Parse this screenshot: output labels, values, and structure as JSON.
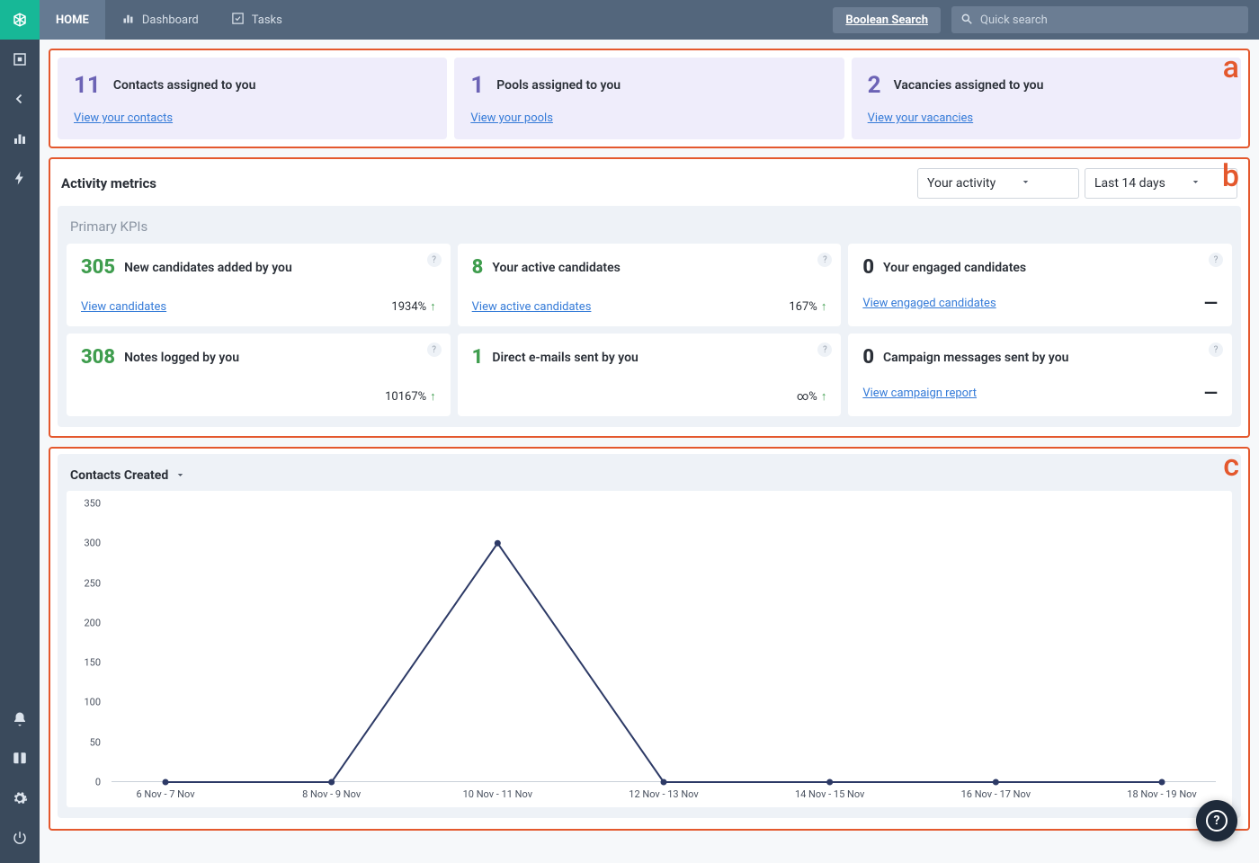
{
  "nav": {
    "home": "HOME",
    "dashboard": "Dashboard",
    "tasks": "Tasks",
    "booleanSearch": "Boolean Search",
    "quickSearchPlaceholder": "Quick search"
  },
  "annotations": {
    "a": "a",
    "b": "b",
    "c": "c"
  },
  "summary": [
    {
      "count": "11",
      "title": "Contacts assigned to you",
      "link": "View your contacts"
    },
    {
      "count": "1",
      "title": "Pools assigned to you",
      "link": "View your pools"
    },
    {
      "count": "2",
      "title": "Vacancies assigned to you",
      "link": "View your vacancies"
    }
  ],
  "metrics": {
    "title": "Activity metrics",
    "activitySelect": "Your activity",
    "rangeSelect": "Last 14 days",
    "kpiHeading": "Primary KPIs",
    "kpis": [
      {
        "value": "305",
        "valueStyle": "green",
        "label": "New candidates added by you",
        "link": "View candidates",
        "delta": "1934%",
        "trend": "up"
      },
      {
        "value": "8",
        "valueStyle": "green",
        "label": "Your active candidates",
        "link": "View active candidates",
        "delta": "167%",
        "trend": "up"
      },
      {
        "value": "0",
        "valueStyle": "dark",
        "label": "Your engaged candidates",
        "link": "View engaged candidates",
        "delta": "",
        "trend": "dash"
      },
      {
        "value": "308",
        "valueStyle": "green",
        "label": "Notes logged by you",
        "link": "",
        "delta": "10167%",
        "trend": "up"
      },
      {
        "value": "1",
        "valueStyle": "green",
        "label": "Direct e-mails sent by you",
        "link": "",
        "delta": "∞%",
        "trend": "up"
      },
      {
        "value": "0",
        "valueStyle": "dark",
        "label": "Campaign messages sent by you",
        "link": "View campaign report",
        "delta": "",
        "trend": "dash"
      }
    ]
  },
  "chart": {
    "title": "Contacts Created"
  },
  "chart_data": {
    "type": "line",
    "title": "Contacts Created",
    "xlabel": "",
    "ylabel": "",
    "ylim": [
      0,
      350
    ],
    "yticks": [
      0,
      50,
      100,
      150,
      200,
      250,
      300,
      350
    ],
    "categories": [
      "6 Nov - 7 Nov",
      "8 Nov - 9 Nov",
      "10 Nov - 11 Nov",
      "12 Nov - 13 Nov",
      "14 Nov - 15 Nov",
      "16 Nov - 17 Nov",
      "18 Nov - 19 Nov"
    ],
    "series": [
      {
        "name": "Contacts Created",
        "color": "#2d3a66",
        "values": [
          0,
          0,
          300,
          0,
          0,
          0,
          0
        ]
      }
    ]
  }
}
